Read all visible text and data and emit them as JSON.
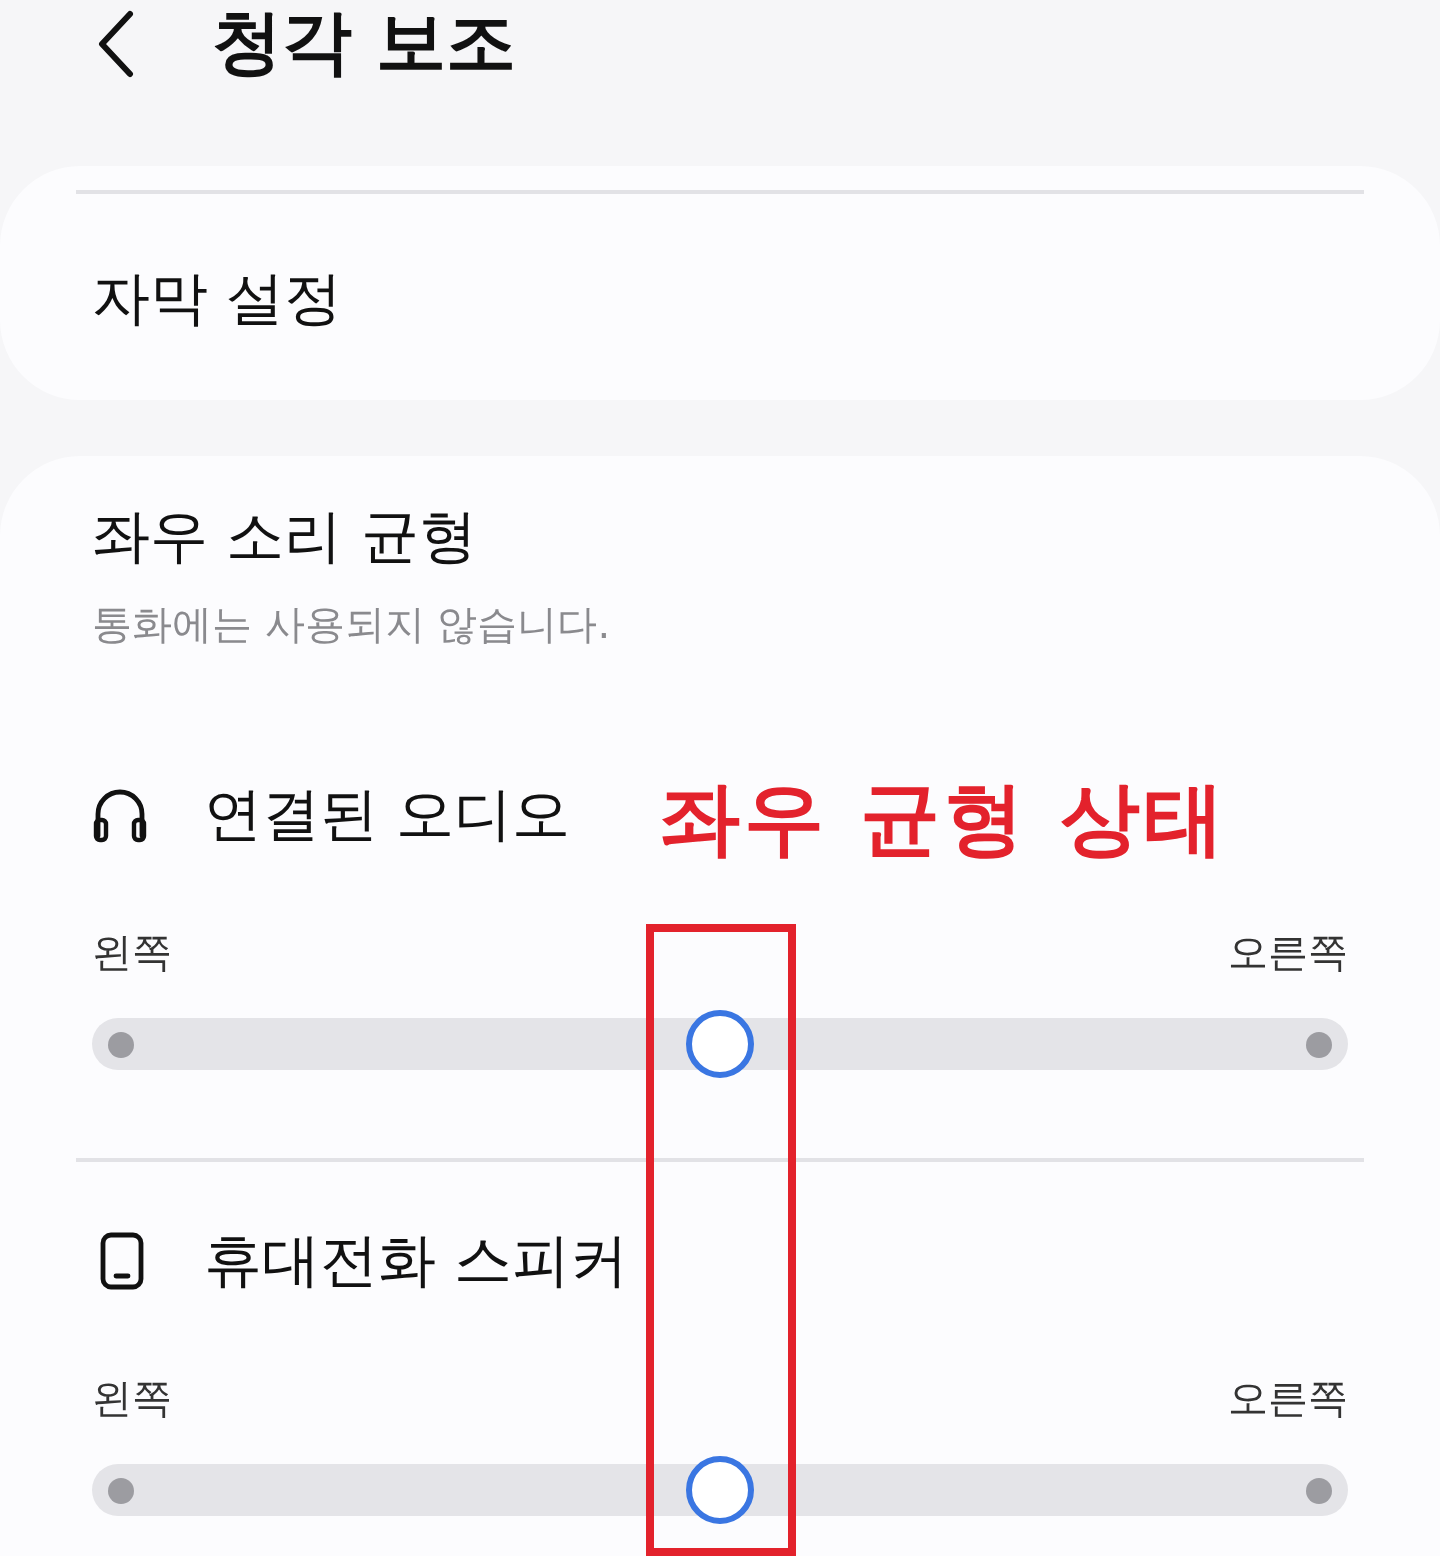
{
  "header": {
    "title": "청각 보조"
  },
  "caption_card": {
    "items": [
      {
        "label": "자막 설정"
      }
    ]
  },
  "balance_section": {
    "title": "좌우 소리 균형",
    "subtitle": "통화에는 사용되지 않습니다.",
    "sliders": [
      {
        "kind": "headphones",
        "label": "연결된 오디오",
        "left_label": "왼쪽",
        "right_label": "오른쪽",
        "level": 0.5
      },
      {
        "kind": "phone",
        "label": "휴대전화 스피커",
        "left_label": "왼쪽",
        "right_label": "오른쪽",
        "level": 0.5
      }
    ]
  },
  "annotation": {
    "text": "좌우 균형 상태"
  }
}
